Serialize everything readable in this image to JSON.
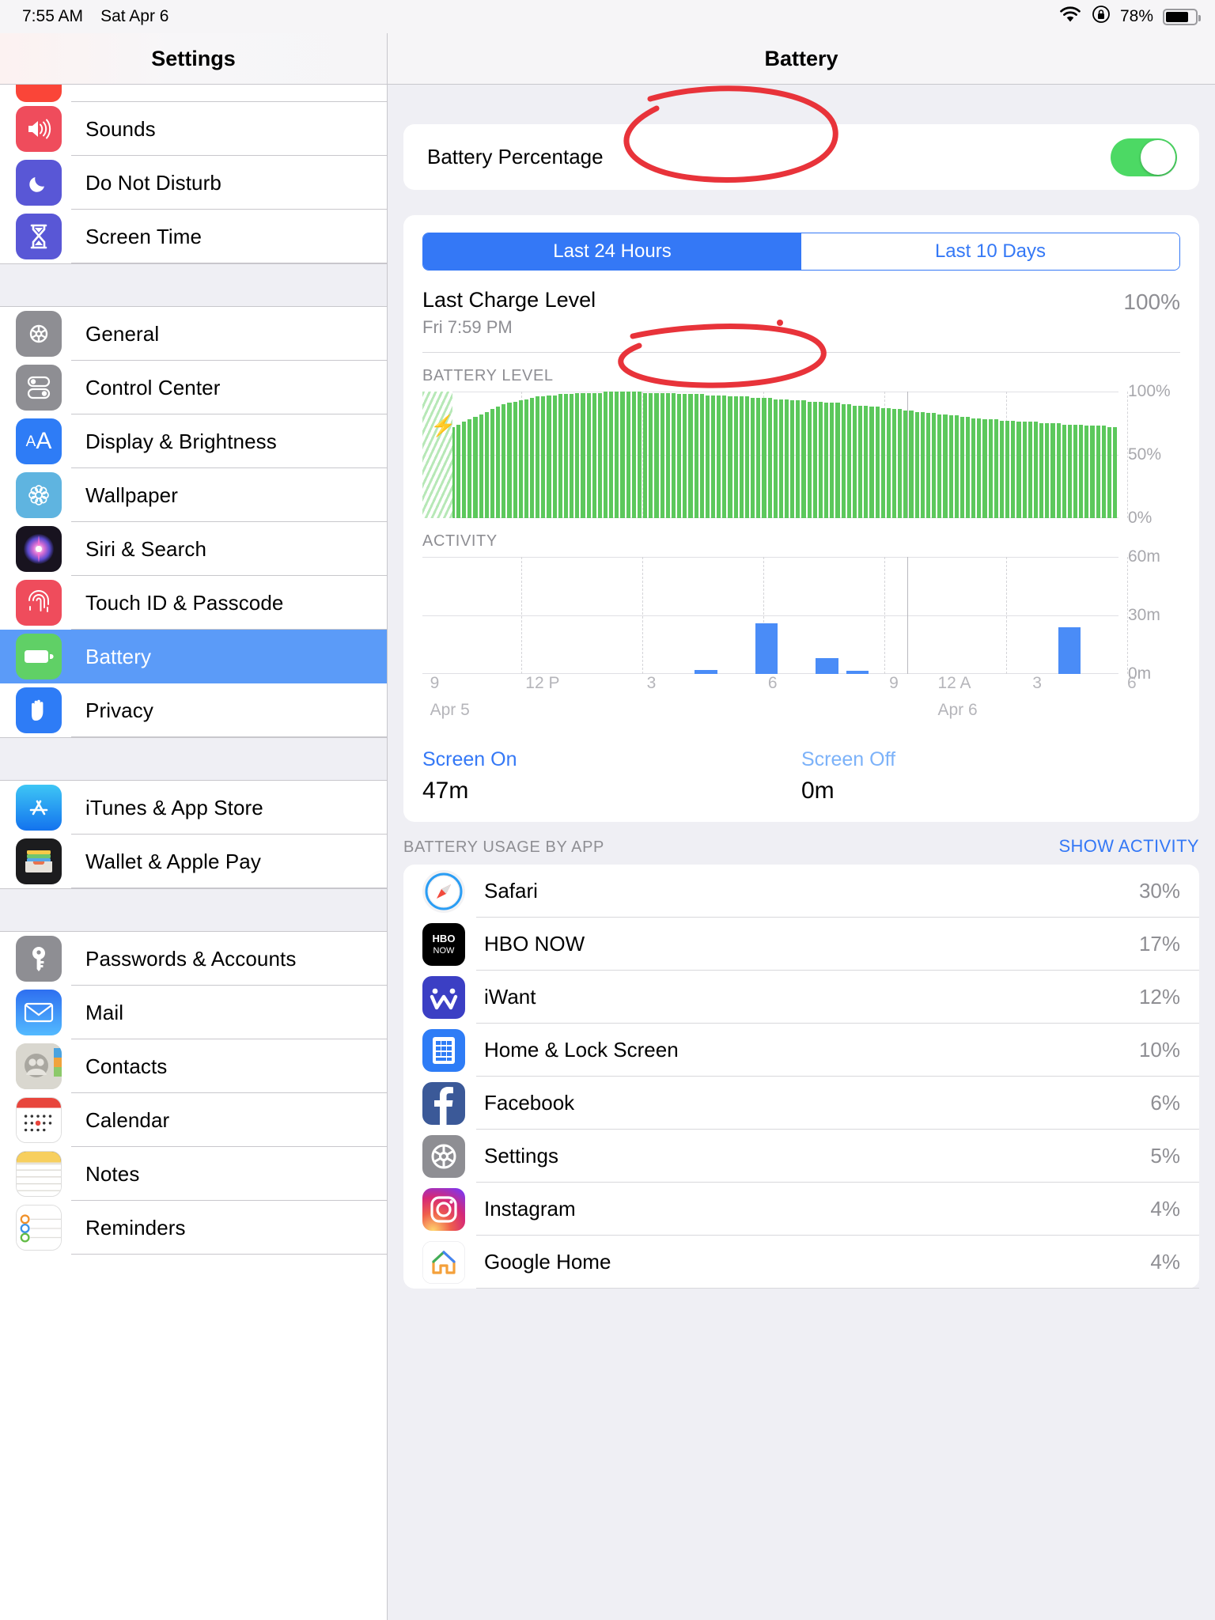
{
  "status_bar": {
    "time": "7:55 AM",
    "date": "Sat Apr 6",
    "wifi_icon": "wifi-icon",
    "rotation_lock_icon": "rotation-lock-icon",
    "battery_percent": "78%",
    "battery_icon": "battery-icon"
  },
  "sidebar": {
    "title": "Settings",
    "groups": [
      {
        "items": [
          {
            "label": "",
            "icon": "notifications-icon",
            "clipped": true
          },
          {
            "label": "Sounds",
            "icon": "sounds-icon"
          },
          {
            "label": "Do Not Disturb",
            "icon": "do-not-disturb-icon"
          },
          {
            "label": "Screen Time",
            "icon": "screen-time-icon"
          }
        ]
      },
      {
        "items": [
          {
            "label": "General",
            "icon": "general-icon"
          },
          {
            "label": "Control Center",
            "icon": "control-center-icon"
          },
          {
            "label": "Display & Brightness",
            "icon": "display-brightness-icon"
          },
          {
            "label": "Wallpaper",
            "icon": "wallpaper-icon"
          },
          {
            "label": "Siri & Search",
            "icon": "siri-search-icon"
          },
          {
            "label": "Touch ID & Passcode",
            "icon": "touch-id-icon"
          },
          {
            "label": "Battery",
            "icon": "battery-icon",
            "selected": true
          },
          {
            "label": "Privacy",
            "icon": "privacy-icon"
          }
        ]
      },
      {
        "items": [
          {
            "label": "iTunes & App Store",
            "icon": "app-store-icon"
          },
          {
            "label": "Wallet & Apple Pay",
            "icon": "wallet-icon"
          }
        ]
      },
      {
        "items": [
          {
            "label": "Passwords & Accounts",
            "icon": "passwords-icon"
          },
          {
            "label": "Mail",
            "icon": "mail-icon"
          },
          {
            "label": "Contacts",
            "icon": "contacts-icon"
          },
          {
            "label": "Calendar",
            "icon": "calendar-icon"
          },
          {
            "label": "Notes",
            "icon": "notes-icon"
          },
          {
            "label": "Reminders",
            "icon": "reminders-icon"
          }
        ]
      }
    ]
  },
  "detail": {
    "title": "Battery",
    "battery_percentage_label": "Battery Percentage",
    "battery_percentage_on": true,
    "segments": [
      {
        "label": "Last 24 Hours",
        "selected": true
      },
      {
        "label": "Last 10 Days",
        "selected": false
      }
    ],
    "last_charge": {
      "title": "Last Charge Level",
      "subtitle": "Fri 7:59 PM",
      "value": "100%"
    },
    "battery_level_label": "BATTERY LEVEL",
    "activity_label": "ACTIVITY",
    "screen_on": {
      "label": "Screen On",
      "value": "47m"
    },
    "screen_off": {
      "label": "Screen Off",
      "value": "0m"
    },
    "usage_header": "BATTERY USAGE BY APP",
    "show_activity": "SHOW ACTIVITY",
    "apps": [
      {
        "name": "Safari",
        "value": "30%",
        "icon": "safari-icon"
      },
      {
        "name": "HBO NOW",
        "value": "17%",
        "icon": "hbo-now-icon"
      },
      {
        "name": "iWant",
        "value": "12%",
        "icon": "iwant-icon"
      },
      {
        "name": "Home & Lock Screen",
        "value": "10%",
        "icon": "home-lock-screen-icon"
      },
      {
        "name": "Facebook",
        "value": "6%",
        "icon": "facebook-icon"
      },
      {
        "name": "Settings",
        "value": "5%",
        "icon": "settings-icon"
      },
      {
        "name": "Instagram",
        "value": "4%",
        "icon": "instagram-icon"
      },
      {
        "name": "Google Home",
        "value": "4%",
        "icon": "google-home-icon"
      }
    ],
    "annotations": [
      {
        "name": "battery-level-circle",
        "color": "#e8333a"
      },
      {
        "name": "activity-circle",
        "color": "#e8333a"
      }
    ]
  },
  "chart_data": [
    {
      "type": "bar",
      "title": "BATTERY LEVEL",
      "ylabel": "",
      "xlabel": "",
      "ylim": [
        0,
        100
      ],
      "ytick_labels": [
        "100%",
        "50%",
        "0%"
      ],
      "ytick_values": [
        100,
        50,
        0
      ],
      "grid": true,
      "color": "#5cc85c",
      "x": [
        "9",
        "12 P",
        "3",
        "6",
        "9",
        "12 A",
        "3",
        "6"
      ],
      "values": [
        62,
        64,
        66,
        68,
        70,
        72,
        74,
        76,
        78,
        80,
        82,
        84,
        86,
        88,
        90,
        91,
        92,
        93,
        94,
        95,
        96,
        96,
        97,
        97,
        98,
        98,
        98,
        99,
        99,
        99,
        99,
        99,
        100,
        100,
        100,
        100,
        100,
        100,
        100,
        99,
        99,
        99,
        99,
        99,
        99,
        98,
        98,
        98,
        98,
        98,
        97,
        97,
        97,
        97,
        96,
        96,
        96,
        96,
        95,
        95,
        95,
        95,
        94,
        94,
        94,
        93,
        93,
        93,
        92,
        92,
        92,
        91,
        91,
        91,
        90,
        90,
        89,
        89,
        89,
        88,
        88,
        87,
        87,
        86,
        86,
        85,
        85,
        84,
        84,
        83,
        83,
        82,
        82,
        81,
        81,
        80,
        80,
        79,
        79,
        78,
        78,
        78,
        77,
        77,
        77,
        76,
        76,
        76,
        76,
        75,
        75,
        75,
        75,
        74,
        74,
        74,
        74,
        73,
        73,
        73,
        73,
        72,
        72
      ]
    },
    {
      "type": "bar",
      "title": "ACTIVITY",
      "ylabel": "",
      "xlabel": "",
      "ylim": [
        0,
        60
      ],
      "ytick_labels": [
        "60m",
        "30m",
        "0m"
      ],
      "ytick_values": [
        60,
        30,
        0
      ],
      "grid": true,
      "color": "#4a8cf7",
      "x": [
        "9",
        "12 P",
        "3",
        "6",
        "9",
        "12 A",
        "3",
        "6"
      ],
      "date_labels": [
        "Apr 5",
        "Apr 6"
      ],
      "categories": [
        "9",
        "10",
        "11",
        "12 P",
        "1",
        "2",
        "3",
        "4",
        "5",
        "6",
        "7",
        "8",
        "9",
        "10",
        "11",
        "12 A",
        "1",
        "2",
        "3",
        "4",
        "5",
        "6",
        "7"
      ],
      "values": [
        0,
        0,
        0,
        0,
        0,
        0,
        0,
        0,
        0,
        2,
        0,
        26,
        0,
        8,
        1,
        0,
        0,
        0,
        0,
        0,
        0,
        24,
        0
      ]
    }
  ]
}
